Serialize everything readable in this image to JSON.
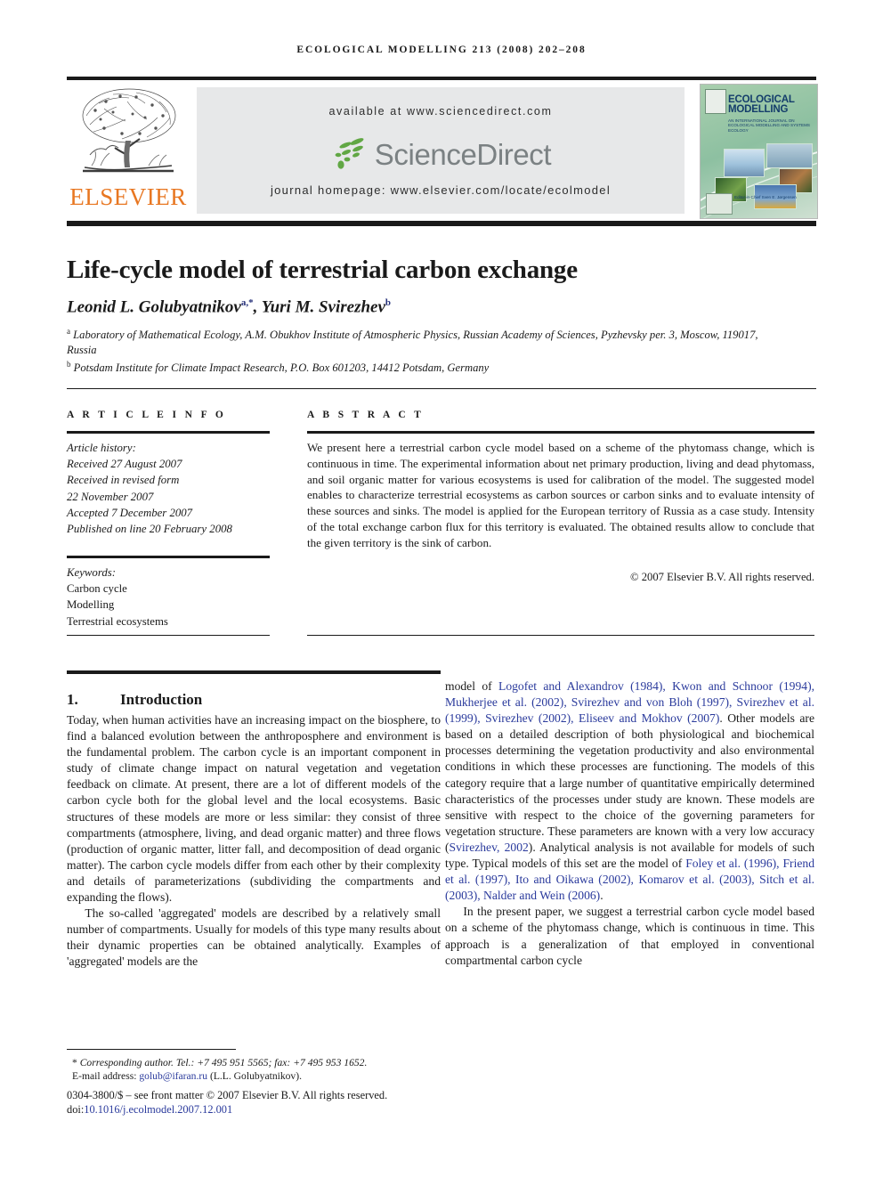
{
  "running_head": "Ecological Modelling  213 (2008) 202–208",
  "masthead": {
    "publisher_name": "ELSEVIER",
    "available_at": "available at www.sciencedirect.com",
    "sciencedirect_word": "ScienceDirect",
    "journal_homepage": "journal homepage: www.elsevier.com/locate/ecolmodel"
  },
  "cover": {
    "title": "ECOLOGICAL MODELLING",
    "subtitle": "AN INTERNATIONAL JOURNAL ON ECOLOGICAL MODELLING AND SYSTEMS ECOLOGY",
    "footer": "Editor-in-Chief Sven E. Jørgensen"
  },
  "article": {
    "title": "Life-cycle model of terrestrial carbon exchange",
    "authors_html": "Leonid L. Golubyatnikov<sup>a,*</sup>, Yuri M. Svirezhev<sup>b</sup>",
    "affiliation_a": "Laboratory of Mathematical Ecology, A.M. Obukhov Institute of Atmospheric Physics, Russian Academy of Sciences, Pyzhevsky per. 3, Moscow, 119017, Russia",
    "affiliation_b": "Potsdam Institute for Climate Impact Research, P.O. Box 601203, 14412 Potsdam, Germany"
  },
  "info": {
    "heading": "A R T I C L E  I N F O",
    "history_label": "Article history:",
    "received": "Received 27 August 2007",
    "revised_label": "Received in revised form",
    "revised_date": "22 November 2007",
    "accepted": "Accepted 7 December 2007",
    "published": "Published on line 20 February 2008",
    "keywords_label": "Keywords:",
    "keywords": [
      "Carbon cycle",
      "Modelling",
      "Terrestrial ecosystems"
    ]
  },
  "abstract": {
    "heading": "A B S T R A C T",
    "text": "We present here a terrestrial carbon cycle model based on a scheme of the phytomass change, which is continuous in time. The experimental information about net primary production, living and dead phytomass, and soil organic matter for various ecosystems is used for calibration of the model. The suggested model enables to characterize terrestrial ecosystems as carbon sources or carbon sinks and to evaluate intensity of these sources and sinks. The model is applied for the European territory of Russia as a case study. Intensity of the total exchange carbon flux for this territory is evaluated. The obtained results allow to conclude that the given territory is the sink of carbon.",
    "copyright": "© 2007 Elsevier B.V. All rights reserved."
  },
  "body": {
    "section_number": "1.",
    "section_title": "Introduction",
    "left_p1": "Today, when human activities have an increasing impact on the biosphere, to find a balanced evolution between the anthroposphere and environment is the fundamental problem. The carbon cycle is an important component in study of climate change impact on natural vegetation and vegetation feedback on climate. At present, there are a lot of different models of the carbon cycle both for the global level and the local ecosystems. Basic structures of these models are more or less similar: they consist of three compartments (atmosphere, living, and dead organic matter) and three flows (production of organic matter, litter fall, and decomposition of dead organic matter). The carbon cycle models differ from each other by their complexity and details of parameterizations (subdividing the compartments and expanding the flows).",
    "left_p2": "The so-called 'aggregated' models are described by a relatively small number of compartments. Usually for models of this type many results about their dynamic properties can be obtained analytically. Examples of 'aggregated' models are the",
    "right_p1_pre": "model of ",
    "right_p1_refs_1": "Logofet and Alexandrov (1984), Kwon and Schnoor (1994), Mukherjee et al. (2002), Svirezhev and von Bloh (1997), Svirezhev et al. (1999), Svirezhev (2002), Eliseev and Mokhov (2007)",
    "right_p1_mid": ". Other models are based on a detailed description of both physiological and biochemical processes determining the vegetation productivity and also environmental conditions in which these processes are functioning. The models of this category require that a large number of quantitative empirically determined characteristics of the processes under study are known. These models are sensitive with respect to the choice of the governing parameters for vegetation structure. These parameters are known with a very low accuracy (",
    "right_p1_ref2": "Svirezhev, 2002",
    "right_p1_mid2": "). Analytical analysis is not available for models of such type. Typical models of this set are the model of ",
    "right_p1_refs_3": "Foley et al. (1996), Friend et al. (1997), Ito and Oikawa (2002), Komarov et al. (2003), Sitch et al. (2003), Nalder and Wein (2006)",
    "right_p1_end": ".",
    "right_p2": "In the present paper, we suggest a terrestrial carbon cycle model based on a scheme of the phytomass change, which is continuous in time. This approach is a generalization of that employed in conventional compartmental carbon cycle"
  },
  "footer": {
    "corresponding": "Corresponding author. Tel.: +7 495 951 5565; fax: +7 495 953 1652.",
    "email_label": "E-mail address:",
    "email": "golub@ifaran.ru",
    "email_owner": "(L.L. Golubyatnikov).",
    "issn_line": "0304-3800/$ – see front matter © 2007 Elsevier B.V. All rights reserved.",
    "doi_label": "doi:",
    "doi": "10.1016/j.ecolmodel.2007.12.001"
  }
}
